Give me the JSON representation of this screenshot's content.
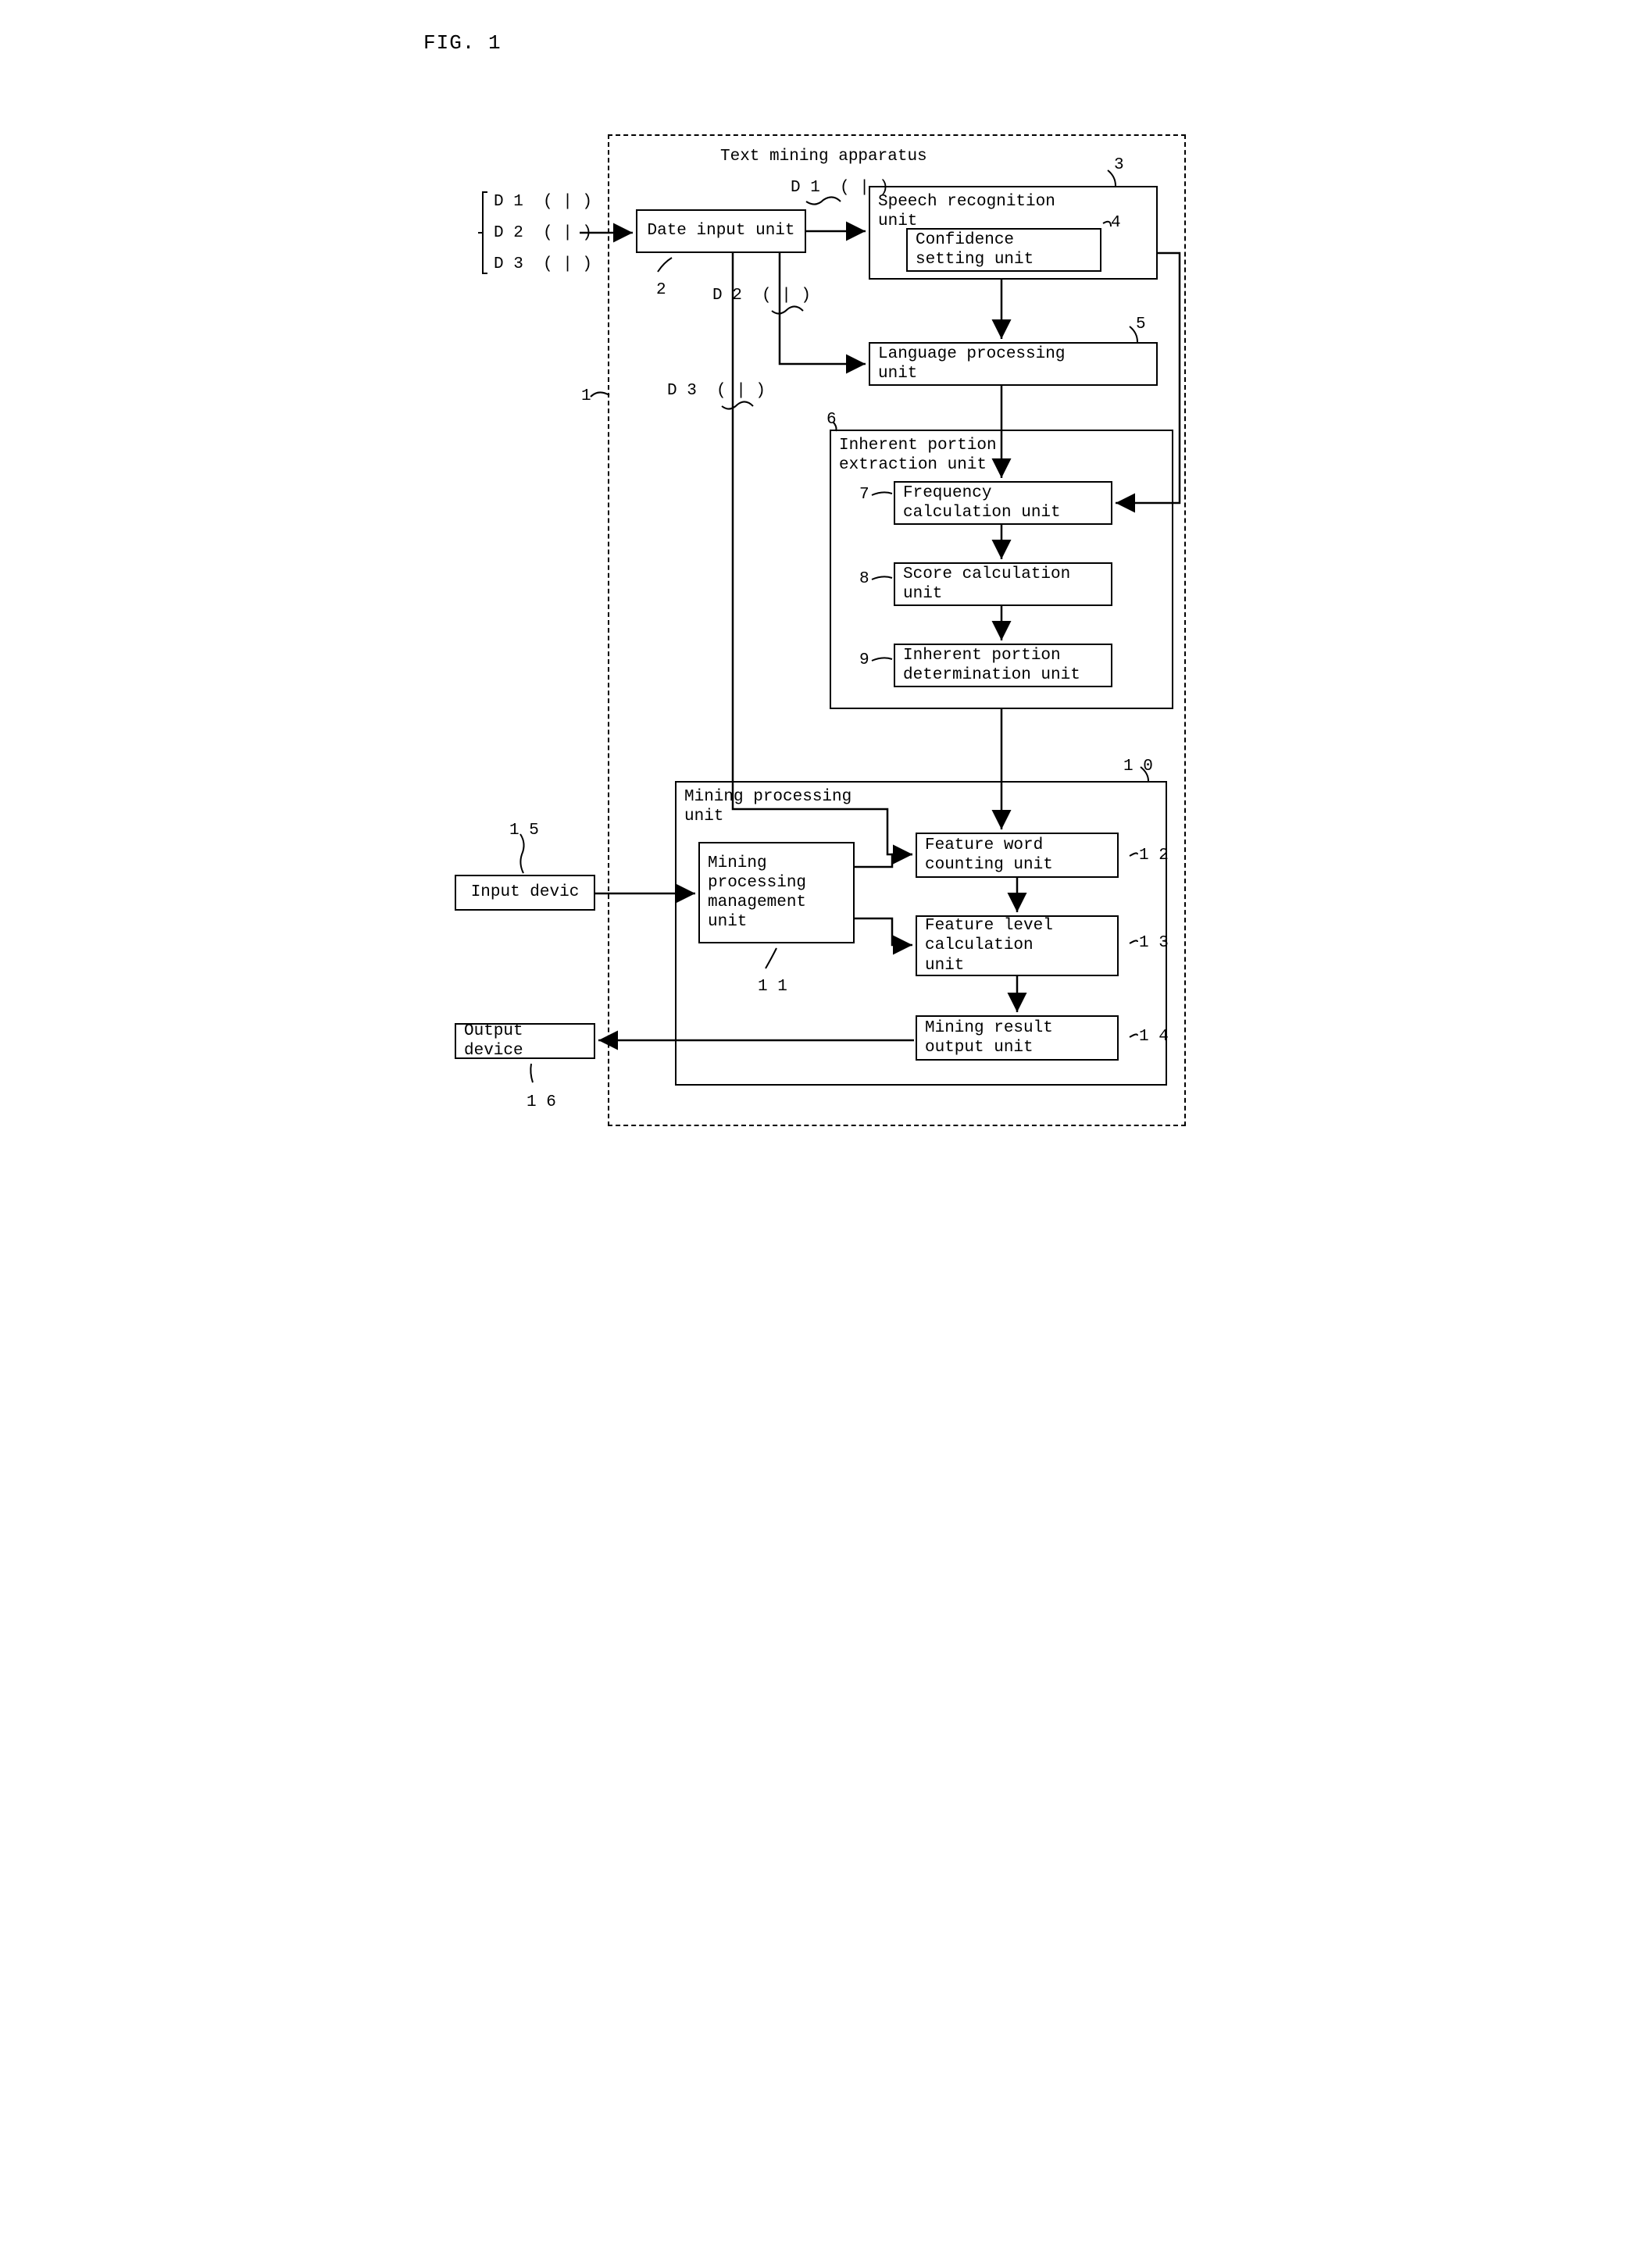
{
  "figLabel": "FIG. 1",
  "inputs": {
    "d1": "D 1  ( | )",
    "d2": "D 2  ( | )",
    "d3": "D 3  ( | )"
  },
  "apparatusTitle": "Text mining apparatus",
  "blocks": {
    "dataInput": "Date input unit",
    "speechRec": "Speech recognition\nunit",
    "confidence": "Confidence\nsetting unit",
    "langProc": "Language processing\nunit",
    "inherentExt": "Inherent portion\nextraction unit",
    "freqCalc": "Frequency\ncalculation unit",
    "scoreCalc": "Score calculation\nunit",
    "inherentDet": "Inherent portion\ndetermination unit",
    "miningProc": "Mining processing\nunit",
    "miningMgmt": "Mining\nprocessing\nmanagement\nunit",
    "featureWord": "Feature word\ncounting unit",
    "featureLevel": "Feature level\ncalculation\nunit",
    "miningResult": "Mining result\noutput unit",
    "inputDevice": "Input devic",
    "outputDevice": "Output device"
  },
  "pathLabels": {
    "d1": "D 1  ( | )",
    "d2": "D 2  ( | )",
    "d3": "D 3  ( | )"
  },
  "nums": {
    "1": "1",
    "2": "2",
    "3": "3",
    "4": "4",
    "5": "5",
    "6": "6",
    "7": "7",
    "8": "8",
    "9": "9",
    "10": "1 0",
    "11": "1 1",
    "12": "1 2",
    "13": "1 3",
    "14": "1 4",
    "15": "1 5",
    "16": "1 6"
  }
}
